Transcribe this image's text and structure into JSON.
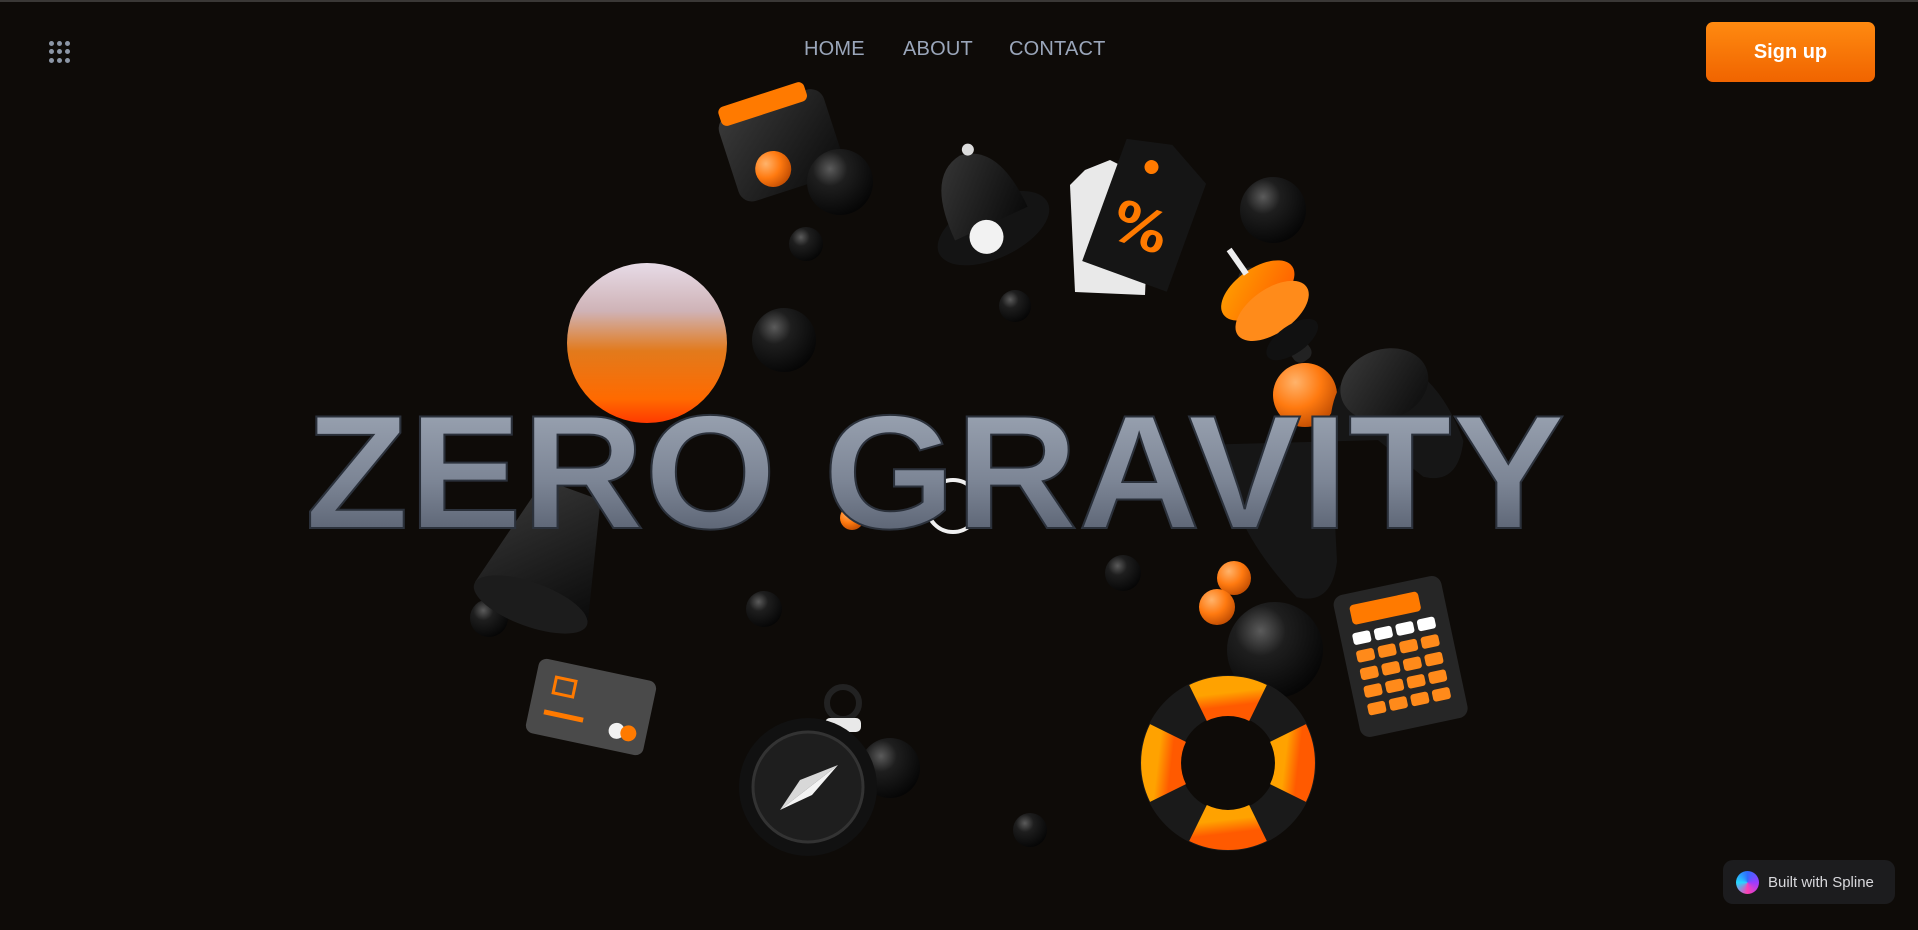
{
  "nav": {
    "home": "HOME",
    "about": "ABOUT",
    "contact": "CONTACT"
  },
  "header": {
    "signup_label": "Sign up",
    "menu_icon": "grid-dots-icon"
  },
  "hero": {
    "title": "ZERO GRAVITY",
    "percent_symbol": "%"
  },
  "badge": {
    "label": "Built with Spline",
    "icon": "spline-logo-icon"
  },
  "colors": {
    "background": "#0e0b08",
    "accent": "#ff7a00",
    "nav_text": "#9aa6ba",
    "title_top": "#9aa3b2",
    "title_bottom": "#4a5262"
  },
  "icons": [
    "wallet-icon",
    "bell-icon",
    "price-tag-icon",
    "dumbbell-icon",
    "sphere-icon",
    "game-controller-icon",
    "megaphone-icon",
    "credit-card-icon",
    "compass-stopwatch-icon",
    "lifebuoy-icon",
    "calculator-icon"
  ]
}
